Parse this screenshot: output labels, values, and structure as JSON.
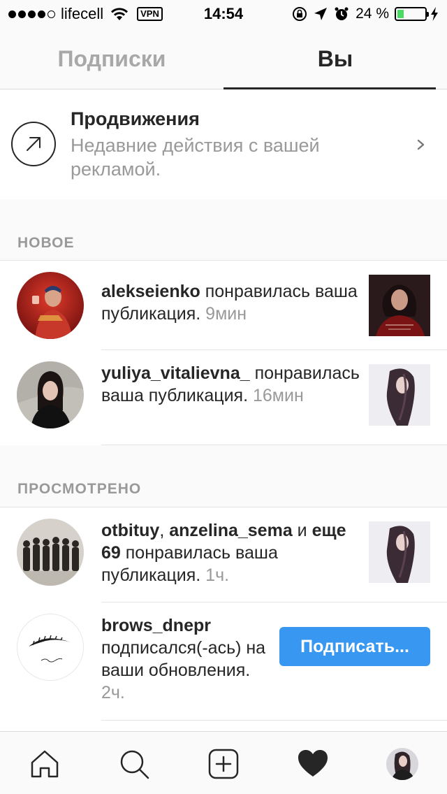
{
  "status_bar": {
    "carrier": "lifecell",
    "vpn": "VPN",
    "time": "14:54",
    "battery": "24 %",
    "battery_level_percent": 24
  },
  "tabs": {
    "following": "Подписки",
    "you": "Вы"
  },
  "promotions": {
    "title": "Продвижения",
    "subtitle": "Недавние действия с вашей рекламой."
  },
  "sections": {
    "new": "НОВОЕ",
    "seen": "ПРОСМОТРЕНО"
  },
  "notifications": {
    "n1": {
      "user": "alekseienko",
      "action": " понравилась ваша публикация. ",
      "time": "9мин"
    },
    "n2": {
      "user": "yuliya_vitalievna_",
      "action": " понравилась ваша публикация. ",
      "time": "16мин"
    },
    "n3": {
      "user1": "otbituy",
      "sep": ", ",
      "user2": "anzelina_sema",
      "and": " и ",
      "more": "еще 69",
      "action": " понравилась ваша публикация. ",
      "time": "1ч."
    },
    "n4": {
      "user": "brows_dnepr",
      "action": " подписался(-ась) на ваши обновления. ",
      "time": "2ч.",
      "button": "Подписать..."
    }
  },
  "colors": {
    "accent": "#3897f0",
    "battery": "#4cd964",
    "muted_text": "#999999"
  },
  "icons": [
    "home-icon",
    "search-icon",
    "add-post-icon",
    "heart-icon",
    "profile-avatar"
  ]
}
